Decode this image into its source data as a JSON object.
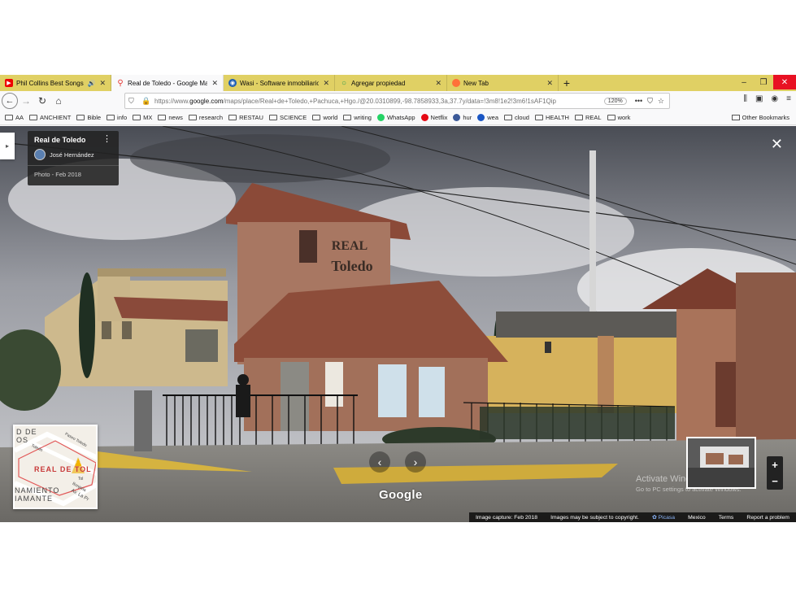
{
  "browser": {
    "tabs": [
      {
        "label": "Phil Collins Best Songs - Ph",
        "favicon": "youtube-icon",
        "audio": true,
        "active": false
      },
      {
        "label": "Real de Toledo - Google Maps",
        "favicon": "maps-pin-icon",
        "active": true
      },
      {
        "label": "Wasi - Software inmobiliario",
        "favicon": "wasi-icon",
        "active": false
      },
      {
        "label": "Agregar propiedad",
        "favicon": "loading-icon",
        "active": false
      },
      {
        "label": "New Tab",
        "favicon": "firefox-icon",
        "active": false
      }
    ],
    "url_prefix": "https://www.",
    "url_domain": "google.com",
    "url_rest": "/maps/place/Real+de+Toledo,+Pachuca,+Hgo./@20.0310899,-98.7858933,3a,37.7y/data=!3m8!1e2!3m6!1sAF1Qip",
    "zoom_label": "120%",
    "more_label": "•••",
    "bookmarks": [
      {
        "label": "AA",
        "type": "folder"
      },
      {
        "label": "ANCHIENT",
        "type": "folder"
      },
      {
        "label": "Bible",
        "type": "folder"
      },
      {
        "label": "info",
        "type": "folder"
      },
      {
        "label": "MX",
        "type": "folder"
      },
      {
        "label": "news",
        "type": "folder"
      },
      {
        "label": "research",
        "type": "folder"
      },
      {
        "label": "RESTAU",
        "type": "folder"
      },
      {
        "label": "SCIENCE",
        "type": "folder"
      },
      {
        "label": "world",
        "type": "folder"
      },
      {
        "label": "writing",
        "type": "folder"
      },
      {
        "label": "WhatsApp",
        "type": "site",
        "color": "#25d366"
      },
      {
        "label": "Netflix",
        "type": "site",
        "color": "#e50914"
      },
      {
        "label": "hur",
        "type": "site",
        "color": "#3b5998"
      },
      {
        "label": "wea",
        "type": "site",
        "color": "#1a56c4"
      },
      {
        "label": "cloud",
        "type": "folder"
      },
      {
        "label": "HEALTH",
        "type": "folder"
      },
      {
        "label": "REAL",
        "type": "folder"
      },
      {
        "label": "work",
        "type": "folder"
      }
    ],
    "other_bookmarks": "Other Bookmarks"
  },
  "streetview": {
    "place_title": "Real de Toledo",
    "author": "José Hernández",
    "photo_date": "Photo - Feb 2018",
    "sign_line1": "REAL",
    "sign_line2": "Toledo",
    "google_logo": "Google",
    "minimap_label_main": "REAL DE TOL",
    "minimap_label_top": "D DE",
    "minimap_label_top2": "OS",
    "minimap_label_bottom1": "NAMIENTO",
    "minimap_label_bottom2": "IAMANTE",
    "minimap_street1": "Toledo",
    "minimap_street2": "Paseo Toledo",
    "minimap_street3": "Av. La Pr",
    "minimap_street4": "Bonjeria",
    "minimap_street5": "Tol",
    "activate_title": "Activate Windows",
    "activate_sub": "Go to PC settings to activate Windows.",
    "footer": {
      "capture": "Image capture: Feb 2018",
      "copyright": "Images may be subject to copyright.",
      "picasa": "Picasa",
      "country": "Mexico",
      "terms": "Terms",
      "report": "Report a problem"
    }
  }
}
